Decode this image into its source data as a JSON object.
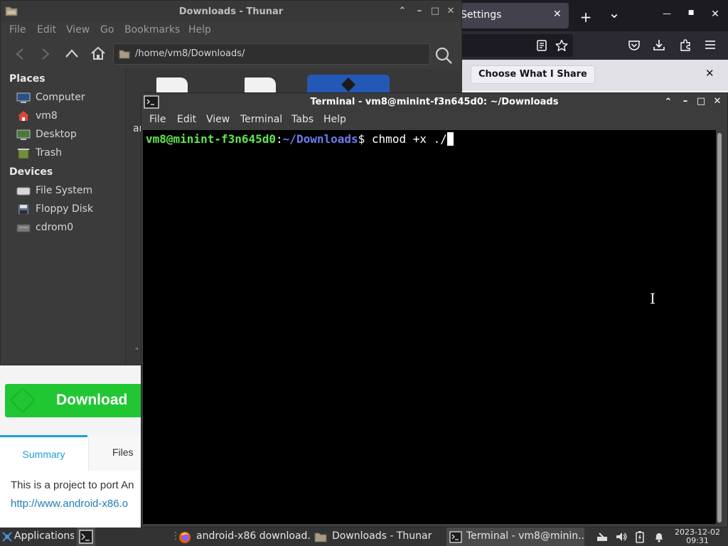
{
  "firefox": {
    "tab_label": "Settings",
    "tab_close": "✕",
    "new_tab": "+",
    "tab_list": "⌄",
    "win_min": "—",
    "win_max": "■",
    "win_close": "✕",
    "info_bar": {
      "button_label": "Choose What I Share",
      "close": "✕"
    },
    "page": {
      "download_label": "Download",
      "tabs": [
        "Summary",
        "Files"
      ],
      "description": "This is a project to port An",
      "link": "http://www.android-x86.o"
    }
  },
  "thunar": {
    "title": "Downloads - Thunar",
    "menu": [
      "File",
      "Edit",
      "View",
      "Go",
      "Bookmarks",
      "Help"
    ],
    "location": "/home/vm8/Downloads/",
    "sidebar": {
      "places_header": "Places",
      "places": [
        "Computer",
        "vm8",
        "Desktop",
        "Trash"
      ],
      "devices_header": "Devices",
      "devices": [
        "File System",
        "Floppy Disk",
        "cdrom0"
      ]
    },
    "partial_file_label": "ar",
    "scroll_marker": "\""
  },
  "terminal": {
    "title": "Terminal - vm8@minint-f3n645d0: ~/Downloads",
    "menu": [
      "File",
      "Edit",
      "View",
      "Terminal",
      "Tabs",
      "Help"
    ],
    "prompt_user": "vm8@minint-f3n645d0",
    "prompt_sep": ":",
    "prompt_path": "~/Downloads",
    "prompt_symbol": "$",
    "command": " chmod +x ./"
  },
  "taskbar": {
    "applications": "Applications",
    "tasks": [
      {
        "label": "android-x86 download...",
        "icon": "firefox-icon"
      },
      {
        "label": "Downloads - Thunar",
        "icon": "folder-icon"
      },
      {
        "label": "Terminal - vm8@minin...",
        "icon": "terminal-icon"
      }
    ],
    "date": "2023-12-02",
    "time": "09:31"
  },
  "colors": {
    "prompt_user": "#5ee84e",
    "prompt_path": "#6d7cf0",
    "download_green": "#20c733",
    "summary_blue": "#1e9edc",
    "thunar_selection": "#2458b5"
  }
}
